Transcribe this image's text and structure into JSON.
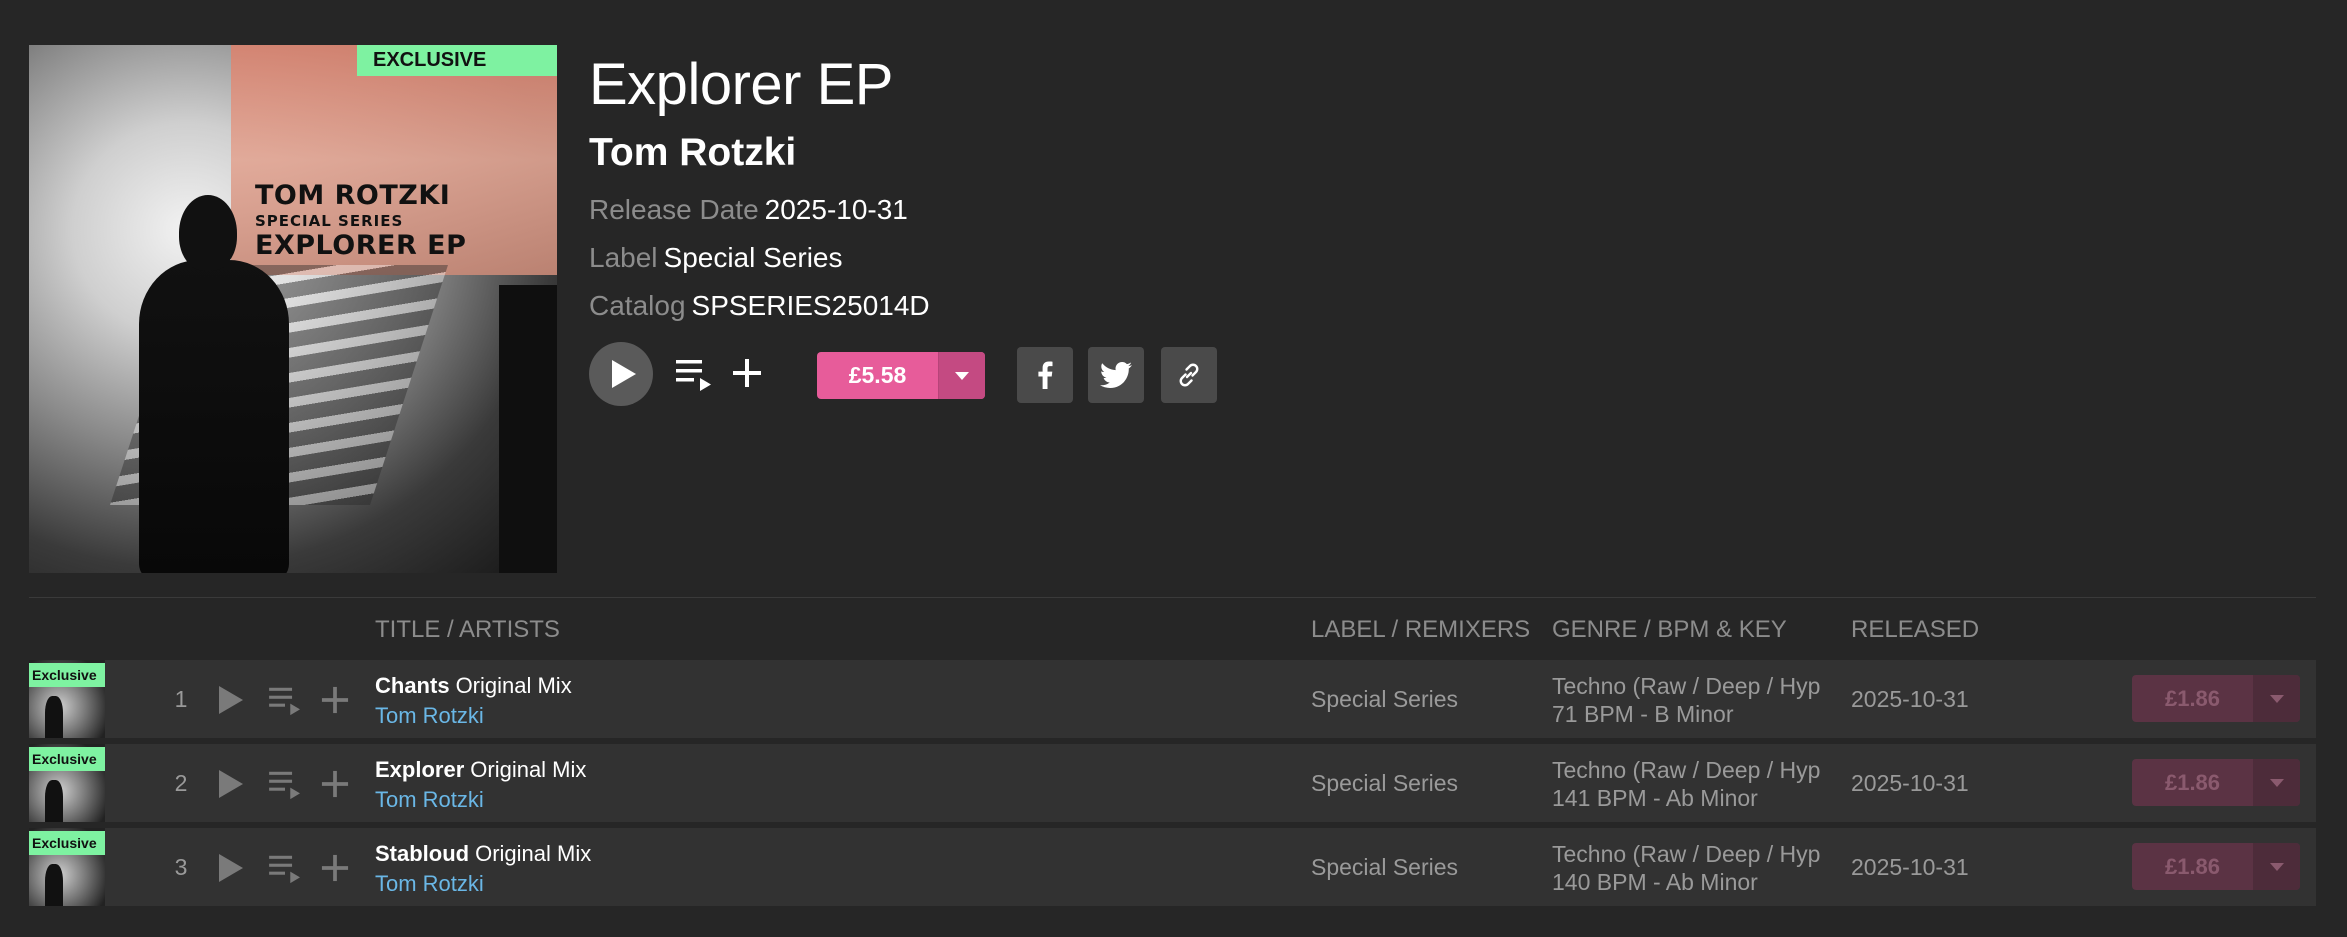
{
  "release": {
    "title": "Explorer EP",
    "artist": "Tom Rotzki",
    "release_date_label": "Release Date",
    "release_date": "2025-10-31",
    "label_label": "Label",
    "label": "Special Series",
    "catalog_label": "Catalog",
    "catalog": "SPSERIES25014D",
    "price": "£5.58",
    "exclusive_tag": "EXCLUSIVE",
    "cover": {
      "artist": "TOM ROTZKI",
      "series": "SPECIAL SERIES",
      "title": "EXPLORER EP"
    }
  },
  "table": {
    "headers": {
      "title": "TITLE / ARTISTS",
      "label": "LABEL / REMIXERS",
      "genre": "GENRE / BPM & KEY",
      "released": "RELEASED"
    },
    "thumb_tag": "Exclusive",
    "tracks": [
      {
        "num": "1",
        "name": "Chants",
        "mix": "Original Mix",
        "artist": "Tom Rotzki",
        "label": "Special Series",
        "genre": "Techno (Raw / Deep / Hypnotic)",
        "bpm_key": "71 BPM - B Minor",
        "released": "2025-10-31",
        "price": "£1.86"
      },
      {
        "num": "2",
        "name": "Explorer",
        "mix": "Original Mix",
        "artist": "Tom Rotzki",
        "label": "Special Series",
        "genre": "Techno (Raw / Deep / Hypnotic)",
        "bpm_key": "141 BPM - Ab Minor",
        "released": "2025-10-31",
        "price": "£1.86"
      },
      {
        "num": "3",
        "name": "Stabloud",
        "mix": "Original Mix",
        "artist": "Tom Rotzki",
        "label": "Special Series",
        "genre": "Techno (Raw / Deep / Hypnotic)",
        "bpm_key": "140 BPM - Ab Minor",
        "released": "2025-10-31",
        "price": "£1.86"
      }
    ]
  },
  "colors": {
    "background": "#262626",
    "accent_pink": "#e75c9a",
    "exclusive_green": "#7ef2a1",
    "artist_link": "#6ab7e6"
  },
  "icons": [
    "play-icon",
    "queue-icon",
    "plus-icon",
    "chevron-down-icon",
    "facebook-icon",
    "twitter-icon",
    "link-icon"
  ]
}
